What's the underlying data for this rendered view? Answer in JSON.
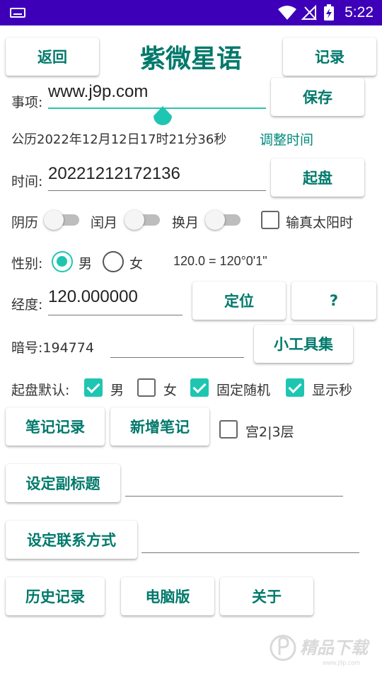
{
  "status": {
    "time": "5:22"
  },
  "header": {
    "back": "返回",
    "title": "紫微星语",
    "record": "记录"
  },
  "item": {
    "label": "事项:",
    "value": "www.j9p.com",
    "save": "保存"
  },
  "solar": {
    "text": "公历2022年12月12日17时21分36秒",
    "adjust": "调整时间"
  },
  "timeRow": {
    "label": "时间:",
    "value": "20221212172136",
    "start": "起盘"
  },
  "toggles": {
    "lunar": "阴历",
    "leap": "闰月",
    "swap": "换月",
    "trueSun": "输真太阳时"
  },
  "gender": {
    "label": "性别:",
    "male": "男",
    "female": "女",
    "note": "120.0 = 120°0'1\""
  },
  "longitude": {
    "label": "经度:",
    "value": "120.000000",
    "locate": "定位",
    "help": "?"
  },
  "code": {
    "label": "暗号:194774",
    "tools": "小工具集"
  },
  "defaults": {
    "label": "起盘默认:",
    "male": "男",
    "female": "女",
    "fixedRandom": "固定随机",
    "showSeconds": "显示秒"
  },
  "notes": {
    "records": "笔记记录",
    "add": "新增笔记",
    "palace": "宫2|3层"
  },
  "subtitle": {
    "button": "设定副标题"
  },
  "contact": {
    "button": "设定联系方式"
  },
  "bottom": {
    "history": "历史记录",
    "pc": "电脑版",
    "about": "关于"
  },
  "colors": {
    "statusbar": "#3d00b8",
    "accent": "#00796b",
    "teal": "#1ec6b2"
  },
  "watermark": {
    "text": "精品下载",
    "url": "www.j9p.com"
  }
}
